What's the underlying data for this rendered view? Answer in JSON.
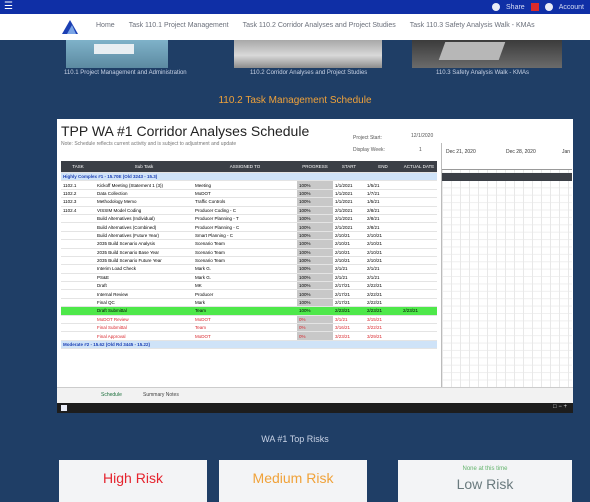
{
  "topbar": {
    "user_label": "Share",
    "profile_label": "Account"
  },
  "nav": {
    "items": [
      "Home",
      "Task 110.1 Project Management",
      "Task 110.2 Corridor Analyses and Project Studies",
      "Task 110.3 Safety Analysis Walk - KMAs"
    ]
  },
  "cards": [
    {
      "label": "110.1 Project Management and Administration"
    },
    {
      "label": "110.2 Corridor Analyses and Project Studies"
    },
    {
      "label": "110.3 Safety Analysis Walk - KMAs"
    }
  ],
  "section_title": "110.2 Task Management Schedule",
  "sheet": {
    "title": "TPP WA #1 Corridor Analyses Schedule",
    "subtitle": "Note: Schedule reflects current activity and is subject to adjustment and update",
    "project_start_label": "Project Start:",
    "project_start_value": "12/1/2020",
    "display_week_label": "Display Week:",
    "display_week_value": "1",
    "gantt_weeks": [
      "Dec 21, 2020",
      "Dec 28, 2020",
      "Jan"
    ],
    "columns": [
      "TASK",
      "Sub Task",
      "ASSIGNED TO",
      "PROGRESS",
      "START",
      "END",
      "ACTUAL DATE"
    ],
    "rows": [
      {
        "type": "hl",
        "cells": [
          "Highly Complex #1 - 15.70E (Old 3243 - 15.3)",
          "",
          "",
          "",
          "",
          "",
          ""
        ]
      },
      {
        "type": "n",
        "cells": [
          "1102.1",
          "Kickoff Meeting (Statement 1 (3))",
          "Meeting",
          "100%",
          "1/1/2021",
          "1/5/21",
          ""
        ]
      },
      {
        "type": "n",
        "cells": [
          "1102.2",
          "Data Collection",
          "MoDOT",
          "100%",
          "1/1/2021",
          "1/7/21",
          ""
        ]
      },
      {
        "type": "n",
        "cells": [
          "1102.3",
          "Methodology Memo",
          "Traffic Controls",
          "100%",
          "1/1/2021",
          "1/5/21",
          ""
        ]
      },
      {
        "type": "n",
        "cells": [
          "1102.4",
          "VISSIM Model Coding",
          "Producer Coding - C",
          "100%",
          "2/1/2021",
          "2/8/21",
          ""
        ]
      },
      {
        "type": "n",
        "cells": [
          "",
          "Build Alternatives (Individual)",
          "Producer Planning - T",
          "100%",
          "2/1/2021",
          "2/8/21",
          ""
        ]
      },
      {
        "type": "n",
        "cells": [
          "",
          "Build Alternatives (Combined)",
          "Producer Planning - C",
          "100%",
          "2/1/2021",
          "2/8/21",
          ""
        ]
      },
      {
        "type": "n",
        "cells": [
          "",
          "Build Alternatives (Future Year)",
          "Smart Planning - C",
          "100%",
          "2/10/21",
          "2/10/21",
          ""
        ]
      },
      {
        "type": "n",
        "cells": [
          "",
          "2035 Build Scenario Analysis",
          "Scenario Team",
          "100%",
          "2/10/21",
          "2/10/21",
          ""
        ]
      },
      {
        "type": "n",
        "cells": [
          "",
          "2035 Build Scenario Base Year",
          "Scenario Team",
          "100%",
          "2/10/21",
          "2/10/21",
          ""
        ]
      },
      {
        "type": "n",
        "cells": [
          "",
          "2035 Build Scenario Future Year",
          "Scenario Team",
          "100%",
          "2/10/21",
          "2/10/21",
          ""
        ]
      },
      {
        "type": "n",
        "cells": [
          "",
          "Interim Load Check",
          "Mark G.",
          "100%",
          "2/1/21",
          "2/1/21",
          ""
        ]
      },
      {
        "type": "n",
        "cells": [
          "",
          "PS&E",
          "Mark G.",
          "100%",
          "2/1/21",
          "2/1/21",
          ""
        ]
      },
      {
        "type": "n",
        "cells": [
          "",
          "Draft",
          "MK",
          "100%",
          "2/17/21",
          "2/22/21",
          ""
        ]
      },
      {
        "type": "n",
        "cells": [
          "",
          "Internal Review",
          "Producer",
          "100%",
          "2/17/21",
          "2/22/21",
          ""
        ]
      },
      {
        "type": "n",
        "cells": [
          "",
          "Final QC",
          "Mark",
          "100%",
          "2/17/21",
          "2/22/21",
          ""
        ]
      },
      {
        "type": "green",
        "cells": [
          "",
          "Draft Submittal",
          "Team",
          "100%",
          "2/23/21",
          "2/23/21",
          "2/23/21"
        ]
      },
      {
        "type": "red",
        "cells": [
          "",
          "MoDOT Review",
          "MoDOT",
          "0%",
          "3/1/21",
          "3/15/21",
          ""
        ]
      },
      {
        "type": "red",
        "cells": [
          "",
          "Final Submittal",
          "Team",
          "0%",
          "3/16/21",
          "3/22/21",
          ""
        ]
      },
      {
        "type": "red",
        "cells": [
          "",
          "Final Approval",
          "MoDOT",
          "0%",
          "3/23/21",
          "3/29/21",
          ""
        ]
      },
      {
        "type": "hl",
        "cells": [
          "Moderate #2 - 15.62 (Old Rd 3445 - 15.22)",
          "",
          "",
          "",
          "",
          "",
          ""
        ]
      }
    ],
    "task_group_label": "1102.4",
    "tabs": [
      "Schedule",
      "Summary Notes"
    ]
  },
  "risks": {
    "title": "WA #1 Top Risks",
    "high": "High Risk",
    "medium": "Medium Risk",
    "low": "Low Risk",
    "low_sub": "None at this time",
    "colors": {
      "high": "#e5242e",
      "medium": "#f0a23a",
      "low": "#6a7a7e",
      "low_sub": "#62b36b"
    }
  }
}
